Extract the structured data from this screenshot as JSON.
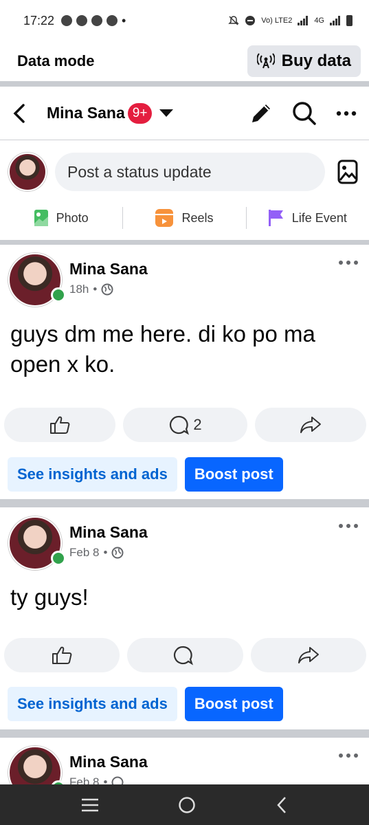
{
  "status_bar": {
    "time": "17:22",
    "network": "4G",
    "lte_label": "Vo) LTE2"
  },
  "data_mode": {
    "label": "Data mode",
    "buy_data_label": "Buy data"
  },
  "nav": {
    "title": "Mina Sana",
    "badge": "9+"
  },
  "composer": {
    "placeholder": "Post a status update",
    "actions": [
      {
        "label": "Photo",
        "icon": "photo-icon"
      },
      {
        "label": "Reels",
        "icon": "reels-icon"
      },
      {
        "label": "Life Event",
        "icon": "flag-icon"
      }
    ]
  },
  "posts": [
    {
      "author": "Mina Sana",
      "time": "18h",
      "separator": "•",
      "text": "guys dm me here. di ko po ma open x ko.",
      "comment_count": "2",
      "insights_label": "See insights and ads",
      "boost_label": "Boost post"
    },
    {
      "author": "Mina Sana",
      "time": "Feb 8",
      "separator": "•",
      "text": "ty guys!",
      "comment_count": "",
      "insights_label": "See insights and ads",
      "boost_label": "Boost post"
    },
    {
      "author": "Mina Sana",
      "time": "Feb 8",
      "separator": "•"
    }
  ],
  "colors": {
    "accent": "#0866ff",
    "insights_bg": "#e7f3ff",
    "online": "#31a24c",
    "badge": "#e41e3f"
  }
}
